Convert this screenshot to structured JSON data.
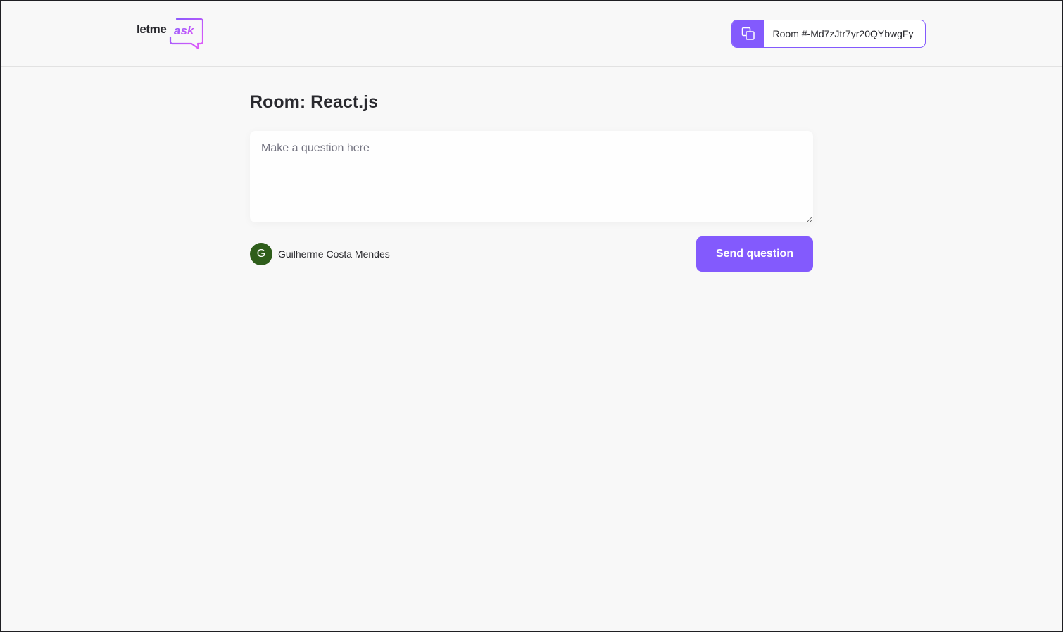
{
  "header": {
    "logo": {
      "text_primary": "letme",
      "text_accent": "ask"
    },
    "room_code": {
      "icon": "copy-icon",
      "label": "Room #-Md7zJtr7yr20QYbwgFy"
    }
  },
  "main": {
    "title": "Room: React.js",
    "question_input": {
      "placeholder": "Make a question here",
      "value": ""
    },
    "user": {
      "avatar_initial": "G",
      "name": "Guilherme Costa Mendes"
    },
    "send_button_label": "Send question"
  },
  "colors": {
    "accent": "#835afd",
    "logo_gradient_start": "#835afd",
    "logo_gradient_end": "#e559f9",
    "avatar_bg": "#2f5e1b",
    "background": "#f8f8f8",
    "text": "#29292e"
  }
}
